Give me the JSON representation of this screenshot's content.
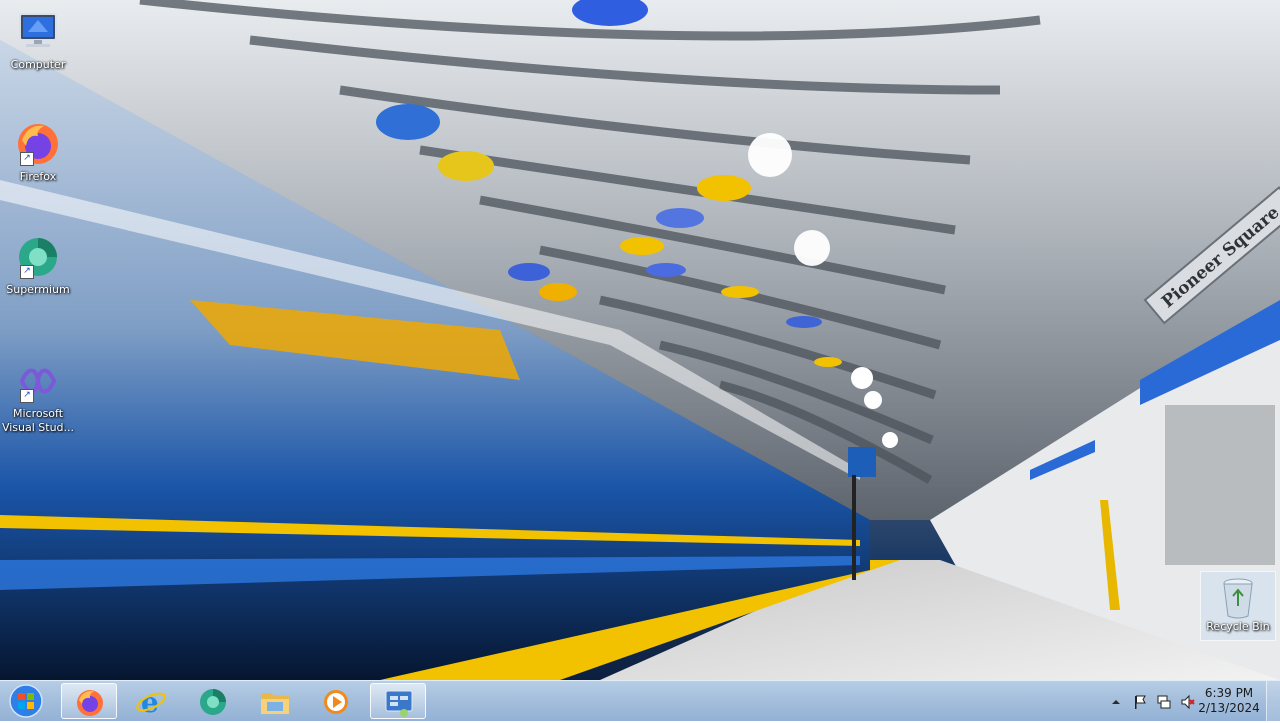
{
  "desktop": {
    "icons": [
      {
        "label": "Computer",
        "icon": "computer-icon"
      },
      {
        "label": "Firefox",
        "icon": "firefox-icon"
      },
      {
        "label": "Supermium",
        "icon": "supermium-icon"
      },
      {
        "label": "Microsoft Visual Stud...",
        "icon": "visual-studio-icon"
      }
    ],
    "recycle_bin": {
      "label": "Recycle Bin",
      "icon": "recycle-bin-icon"
    },
    "wallpaper_sign": "Pioneer Square"
  },
  "taskbar": {
    "start": {
      "icon": "windows-start-icon"
    },
    "pinned": [
      {
        "name": "Firefox",
        "icon": "firefox-icon",
        "active": true
      },
      {
        "name": "Internet Explorer",
        "icon": "internet-explorer-icon",
        "active": false
      },
      {
        "name": "Supermium",
        "icon": "supermium-icon",
        "active": false
      },
      {
        "name": "Windows Explorer",
        "icon": "folder-icon",
        "active": false
      },
      {
        "name": "Windows Media Player",
        "icon": "media-player-icon",
        "active": false
      },
      {
        "name": "Control Panel",
        "icon": "control-panel-icon",
        "active": true
      }
    ],
    "tray": {
      "icons": [
        "show-hidden-icons-arrow",
        "action-center-flag-icon",
        "network-icon",
        "volume-muted-icon"
      ],
      "time": "6:39 PM",
      "date": "2/13/2024"
    }
  },
  "colors": {
    "taskbar": "#a5bfdc",
    "accent_yellow": "#f2c200",
    "accent_blue": "#2f6fd6"
  }
}
